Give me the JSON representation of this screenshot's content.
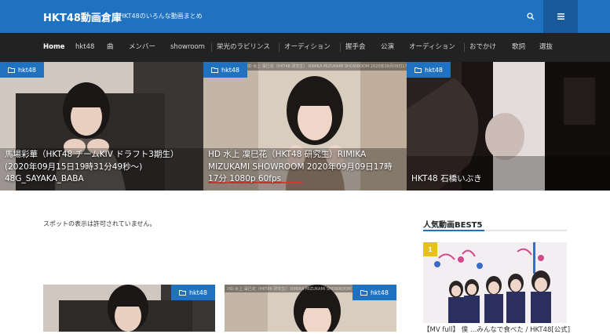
{
  "header": {
    "site_title": "HKT48動画倉庫",
    "site_description": "HKT48のいろんな動画まとめ",
    "search_icon": "search-icon",
    "menu_icon": "hamburger-menu-icon",
    "brand_color": "#1f72c0"
  },
  "nav": {
    "items": [
      {
        "label": "Home",
        "active": true
      },
      {
        "label": "hkt48"
      },
      {
        "label": "曲"
      },
      {
        "label": "メンバー"
      },
      {
        "label": "showroom"
      },
      {
        "label": "栄光のラビリンス"
      },
      {
        "label": "オーディション"
      },
      {
        "label": "握手会"
      },
      {
        "label": "公演"
      },
      {
        "label": "オーディション"
      },
      {
        "label": "おでかけ"
      },
      {
        "label": "歌詞"
      },
      {
        "label": "選抜"
      }
    ]
  },
  "slider": {
    "slides": [
      {
        "category": "hkt48",
        "title": "馬場彩華（HKT48 チームKIV ドラフト3期生）(2020年09月15日19時31分49秒～) 48G_SAYAKA_BABA"
      },
      {
        "category": "hkt48",
        "overlay": "HD 水上 凜巳花（HKT48 研究生） RIMIKA MIZUKAMI SHOWROOM 2020年09月09日17時17分 1080p 60fps",
        "title": "HD 水上 凜巳花（HKT48 研究生）RIMIKA MIZUKAMI SHOWROOM 2020年09月09日17時17分 1080p 60fps"
      },
      {
        "category": "hkt48",
        "title": "HKT48 石橋いぶき"
      }
    ]
  },
  "main": {
    "notice": "スポットの表示は許可されていません。",
    "cards": [
      {
        "category": "hkt48"
      },
      {
        "category": "hkt48",
        "overlay": "HD 水上 凜巳花（HKT48 研究生） RIMIKA MIZUKAMI SHOWROOM"
      }
    ]
  },
  "sidebar": {
    "widget_title": "人気動画BEST5",
    "top_item": {
      "rank": "1",
      "caption": "【MV full】 僕 …みんなで食べた / HKT48[公式]"
    }
  }
}
